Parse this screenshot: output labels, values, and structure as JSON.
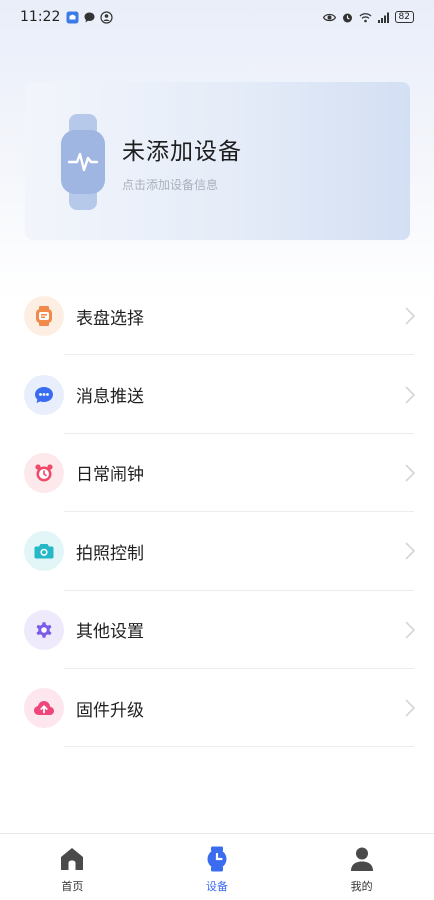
{
  "status_bar": {
    "time": "11:22",
    "battery": "82"
  },
  "device_card": {
    "title": "未添加设备",
    "subtitle": "点击添加设备信息",
    "icon": "smartwatch-icon"
  },
  "menu": {
    "items": [
      {
        "label": "表盘选择",
        "icon": "watch-face-icon",
        "icon_color": "#f08a4b",
        "icon_bg": "#fdeee4"
      },
      {
        "label": "消息推送",
        "icon": "chat-bubble-icon",
        "icon_color": "#3a6cf0",
        "icon_bg": "#e8eefc"
      },
      {
        "label": "日常闹钟",
        "icon": "alarm-clock-icon",
        "icon_color": "#f04a6b",
        "icon_bg": "#fde8ec"
      },
      {
        "label": "拍照控制",
        "icon": "camera-icon",
        "icon_color": "#25b8c8",
        "icon_bg": "#e2f6f8"
      },
      {
        "label": "其他设置",
        "icon": "gear-icon",
        "icon_color": "#7b5ce6",
        "icon_bg": "#eeeafc"
      },
      {
        "label": "固件升级",
        "icon": "cloud-upload-icon",
        "icon_color": "#f0457a",
        "icon_bg": "#fde6ee"
      }
    ]
  },
  "tab_bar": {
    "tabs": [
      {
        "label": "首页",
        "icon": "home-icon",
        "active": false
      },
      {
        "label": "设备",
        "icon": "device-watch-icon",
        "active": true
      },
      {
        "label": "我的",
        "icon": "profile-icon",
        "active": false
      }
    ]
  },
  "colors": {
    "accent": "#3a6cf0",
    "card_gradient_end": "#d3dff3"
  }
}
